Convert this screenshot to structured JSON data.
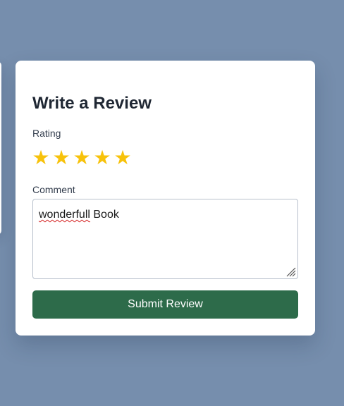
{
  "review_form": {
    "title": "Write a Review",
    "rating_label": "Rating",
    "rating_value": 5,
    "rating_max": 5,
    "stars": [
      {
        "glyph": "★",
        "icon": "star-filled-icon"
      },
      {
        "glyph": "★",
        "icon": "star-filled-icon"
      },
      {
        "glyph": "★",
        "icon": "star-filled-icon"
      },
      {
        "glyph": "★",
        "icon": "star-filled-icon"
      },
      {
        "glyph": "★",
        "icon": "star-filled-icon"
      }
    ],
    "comment_label": "Comment",
    "comment_value_misspelled_word": "wonderfull",
    "comment_value_rest": " Book",
    "submit_label": "Submit Review"
  },
  "colors": {
    "page_background": "#768ead",
    "card_background": "#ffffff",
    "star_color": "#f7c20b",
    "submit_button": "#2d6b4a",
    "spellcheck_underline": "#d42222"
  }
}
